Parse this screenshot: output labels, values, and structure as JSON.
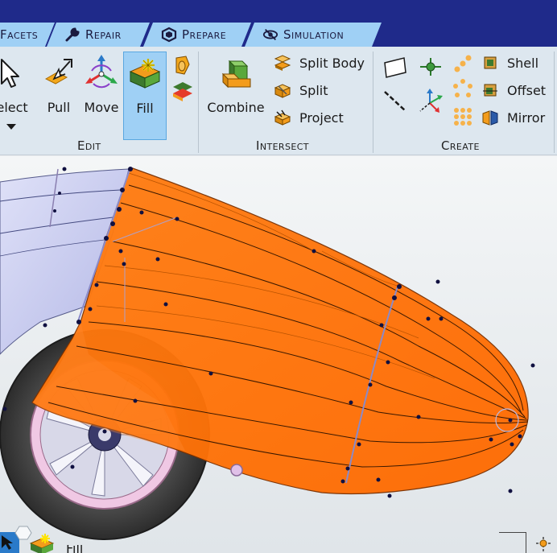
{
  "tabs": [
    {
      "label": "Facets",
      "icon": "facets-icon"
    },
    {
      "label": "Repair",
      "icon": "wrench-icon"
    },
    {
      "label": "Prepare",
      "icon": "prepare-icon"
    },
    {
      "label": "Simulation",
      "icon": "simulation-icon"
    }
  ],
  "ribbon": {
    "edit": {
      "group_label": "Edit",
      "select_label": "Select",
      "pull_label": "Pull",
      "move_label": "Move",
      "fill_label": "Fill"
    },
    "intersect": {
      "group_label": "Intersect",
      "combine_label": "Combine",
      "split_body_label": "Split Body",
      "split_label": "Split",
      "project_label": "Project"
    },
    "create": {
      "group_label": "Create",
      "shell_label": "Shell",
      "offset_label": "Offset",
      "mirror_label": "Mirror"
    }
  },
  "structure_tree": {
    "partial_label": "Fill"
  },
  "colors": {
    "tab_bar": "#1f2a8a",
    "tab": "#9fd0f5",
    "ribbon": "#dde7ef",
    "active_button": "#9fd0f5",
    "selected_body": "#ff7a10",
    "car_body": "#c8cbf0",
    "tire": "#3a3a3a",
    "rim": "#e6b4d8"
  }
}
